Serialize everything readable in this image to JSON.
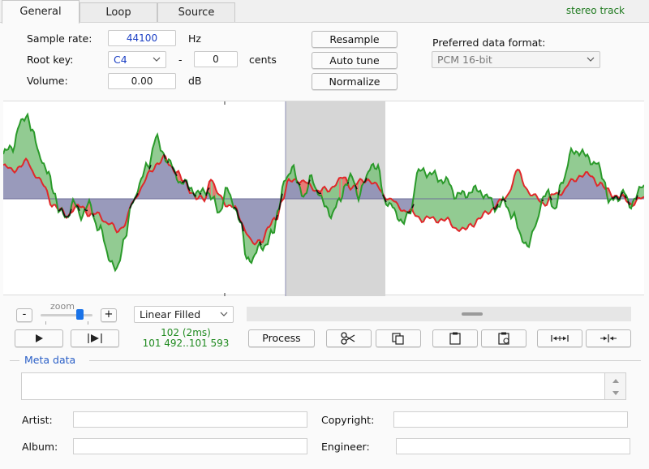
{
  "tabs": [
    {
      "label": "General",
      "active": true
    },
    {
      "label": "Loop",
      "active": false
    },
    {
      "label": "Source",
      "active": false
    }
  ],
  "track_type": "stereo track",
  "sample_rate": {
    "label": "Sample rate:",
    "value": "44100",
    "unit": "Hz"
  },
  "root_key": {
    "label": "Root key:",
    "value": "C4",
    "dash": "-",
    "cents_value": "0",
    "cents_unit": "cents"
  },
  "volume": {
    "label": "Volume:",
    "value": "0.00",
    "unit": "dB"
  },
  "actions": {
    "resample": "Resample",
    "auto_tune": "Auto tune",
    "normalize": "Normalize"
  },
  "data_format": {
    "label": "Preferred data format:",
    "value": "PCM 16-bit"
  },
  "zoom": {
    "minus": "-",
    "plus": "+",
    "label": "zoom",
    "level": 0.75
  },
  "draw_mode": "Linear Filled",
  "selection": {
    "length": "102 (2ms)",
    "range": "101 492..101 593"
  },
  "toolbar": {
    "process": "Process"
  },
  "meta": {
    "title": "Meta data",
    "artist_label": "Artist:",
    "copyright_label": "Copyright:",
    "album_label": "Album:",
    "engineer_label": "Engineer:"
  },
  "colors": {
    "left_channel": "#2a9a2a",
    "right_channel": "#e0282a",
    "fill_overlap": "#8e8fb4",
    "selection": "#d6d6d6"
  },
  "icons": {
    "scissors": "scissors-icon",
    "copy": "copy-icon",
    "paste": "paste-icon",
    "paste_mix": "paste-mix-icon",
    "expand": "expand-icon",
    "shrink": "shrink-icon"
  }
}
